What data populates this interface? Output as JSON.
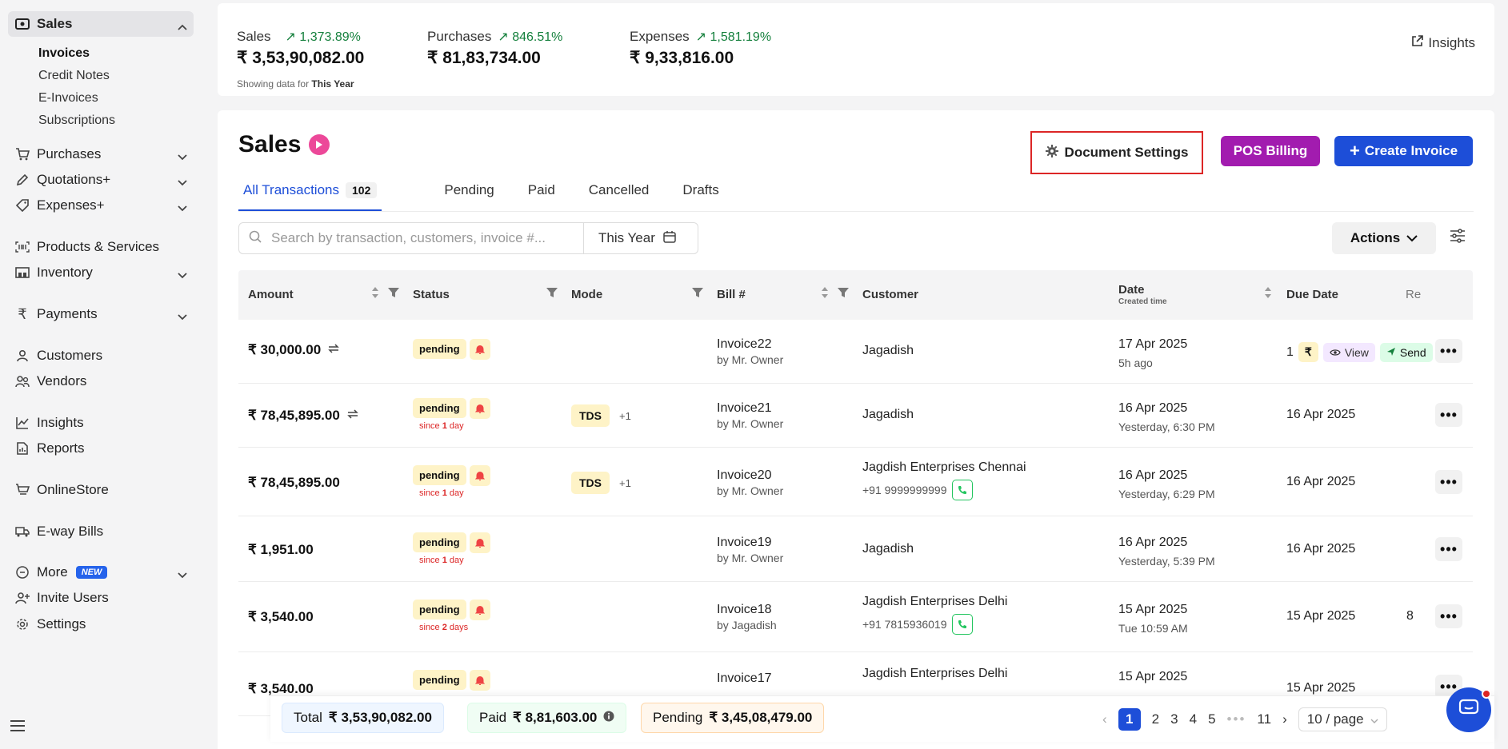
{
  "sidebar": {
    "sales": "Sales",
    "sales_sub": [
      "Invoices",
      "Credit Notes",
      "E-Invoices",
      "Subscriptions"
    ],
    "purchases": "Purchases",
    "quotations": "Quotations+",
    "expenses": "Expenses+",
    "products": "Products & Services",
    "inventory": "Inventory",
    "payments": "Payments",
    "customers": "Customers",
    "vendors": "Vendors",
    "insights": "Insights",
    "reports": "Reports",
    "onlinestore": "OnlineStore",
    "eway": "E-way Bills",
    "more": "More",
    "more_badge": "NEW",
    "invite": "Invite Users",
    "settings": "Settings"
  },
  "stats": {
    "sales_label": "Sales",
    "sales_pct": "1,373.89%",
    "sales_val": "₹ 3,53,90,082.00",
    "purchases_label": "Purchases",
    "purchases_pct": "846.51%",
    "purchases_val": "₹ 81,83,734.00",
    "expenses_label": "Expenses",
    "expenses_pct": "1,581.19%",
    "expenses_val": "₹ 9,33,816.00",
    "showing_prefix": "Showing data for",
    "showing_period": "This Year",
    "insights_link": "Insights",
    "accent_green": "#15803d"
  },
  "main": {
    "title": "Sales",
    "doc_settings": "Document Settings",
    "pos_billing": "POS Billing",
    "create_invoice": "Create Invoice",
    "tabs": [
      {
        "label": "All Transactions",
        "count": "102"
      },
      {
        "label": "Pending"
      },
      {
        "label": "Paid"
      },
      {
        "label": "Cancelled"
      },
      {
        "label": "Drafts"
      }
    ],
    "search_placeholder": "Search by transaction, customers, invoice #...",
    "year_filter": "This Year",
    "actions": "Actions"
  },
  "table": {
    "headers": {
      "amount": "Amount",
      "status": "Status",
      "mode": "Mode",
      "bill": "Bill #",
      "customer": "Customer",
      "date": "Date",
      "date_sub": "Created time",
      "due": "Due Date",
      "re": "Re"
    },
    "rows": [
      {
        "amount": "₹ 30,000.00",
        "status": "pending",
        "since_pre": "",
        "since_num": "",
        "since_post": "",
        "bill": "Invoice22",
        "by": "by Mr. Owner",
        "customer": "Jagadish",
        "phone": "",
        "date": "17 Apr 2025",
        "time": "5h ago",
        "due": "1"
      },
      {
        "amount": "₹ 78,45,895.00",
        "status": "pending",
        "since_pre": "since ",
        "since_num": "1",
        "since_post": " day",
        "mode": "TDS",
        "mode_more": "+1",
        "bill": "Invoice21",
        "by": "by Mr. Owner",
        "customer": "Jagadish",
        "phone": "",
        "date": "16 Apr 2025",
        "time": "Yesterday, 6:30 PM",
        "due": "16 Apr 2025"
      },
      {
        "amount": "₹ 78,45,895.00",
        "status": "pending",
        "since_pre": "since ",
        "since_num": "1",
        "since_post": " day",
        "mode": "TDS",
        "mode_more": "+1",
        "bill": "Invoice20",
        "by": "by Mr. Owner",
        "customer": "Jagdish Enterprises Chennai",
        "phone": "+91  9999999999",
        "date": "16 Apr 2025",
        "time": "Yesterday, 6:29 PM",
        "due": "16 Apr 2025"
      },
      {
        "amount": "₹ 1,951.00",
        "status": "pending",
        "since_pre": "since ",
        "since_num": "1",
        "since_post": " day",
        "bill": "Invoice19",
        "by": "by Mr. Owner",
        "customer": "Jagadish",
        "phone": "",
        "date": "16 Apr 2025",
        "time": "Yesterday, 5:39 PM",
        "due": "16 Apr 2025"
      },
      {
        "amount": "₹ 3,540.00",
        "status": "pending",
        "since_pre": "since ",
        "since_num": "2",
        "since_post": " days",
        "bill": "Invoice18",
        "by": "by Jagadish",
        "customer": "Jagdish Enterprises Delhi",
        "phone": "+91  7815936019",
        "date": "15 Apr 2025",
        "time": "Tue 10:59 AM",
        "due": "15 Apr 2025",
        "extra": "8"
      },
      {
        "amount": "₹ 3,540.00",
        "status": "pending",
        "bill": "Invoice17",
        "customer": "Jagdish Enterprises Delhi",
        "date": "15 Apr 2025",
        "due": "15 Apr 2025"
      }
    ],
    "row0_chips": {
      "view": "View",
      "send": "Send",
      "rupee": "₹"
    }
  },
  "footer": {
    "total_label": "Total",
    "total_val": "₹ 3,53,90,082.00",
    "paid_label": "Paid",
    "paid_val": "₹ 8,81,603.00",
    "pending_label": "Pending",
    "pending_val": "₹ 3,45,08,479.00",
    "pages": [
      "1",
      "2",
      "3",
      "4",
      "5",
      "11"
    ],
    "per_page": "10 / page"
  },
  "icons": {
    "sales": "cash-icon",
    "purchases": "cart-icon",
    "quotations": "pen-icon",
    "expenses": "tag-icon",
    "products": "barcode-icon",
    "inventory": "warehouse-icon",
    "payments": "rupee-icon",
    "customers": "user-icon",
    "vendors": "users-icon",
    "insights": "chart-icon",
    "reports": "report-icon",
    "onlinestore": "store-icon",
    "eway": "truck-icon",
    "more": "more-icon",
    "invite": "user-plus-icon",
    "settings": "gear-icon"
  }
}
